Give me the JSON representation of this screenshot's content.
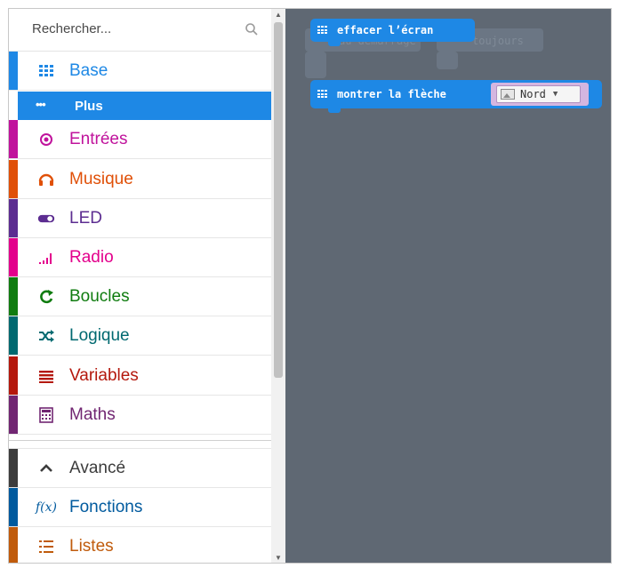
{
  "search": {
    "placeholder": "Rechercher..."
  },
  "toolbox": {
    "categories": [
      {
        "label": "Base",
        "color": "#1e88e5",
        "icon": "grid-icon"
      },
      {
        "label": "Entrées",
        "color": "#c0139c",
        "icon": "target-icon"
      },
      {
        "label": "Musique",
        "color": "#e05008",
        "icon": "headphones-icon"
      },
      {
        "label": "LED",
        "color": "#5c2d91",
        "icon": "toggle-icon"
      },
      {
        "label": "Radio",
        "color": "#e3008c",
        "icon": "signal-icon"
      },
      {
        "label": "Boucles",
        "color": "#107c10",
        "icon": "loop-icon"
      },
      {
        "label": "Logique",
        "color": "#006970",
        "icon": "shuffle-icon"
      },
      {
        "label": "Variables",
        "color": "#b4180d",
        "icon": "lines-icon"
      },
      {
        "label": "Maths",
        "color": "#712672",
        "icon": "calculator-icon"
      },
      {
        "label": "Avancé",
        "color": "#3c3c3c",
        "icon": "chevron-up-icon"
      },
      {
        "label": "Fonctions",
        "color": "#005a9e",
        "icon": "function-icon"
      },
      {
        "label": "Listes",
        "color": "#c05b0c",
        "icon": "list-icon"
      }
    ],
    "subcategory": {
      "label": "Plus",
      "icon": "dots-icon"
    }
  },
  "workspace": {
    "ghost_blocks": [
      "au démarrage",
      "toujours"
    ],
    "blocks": [
      {
        "label": "effacer l’écran"
      },
      {
        "label": "montrer la flèche",
        "dropdown_value": "Nord"
      }
    ]
  }
}
